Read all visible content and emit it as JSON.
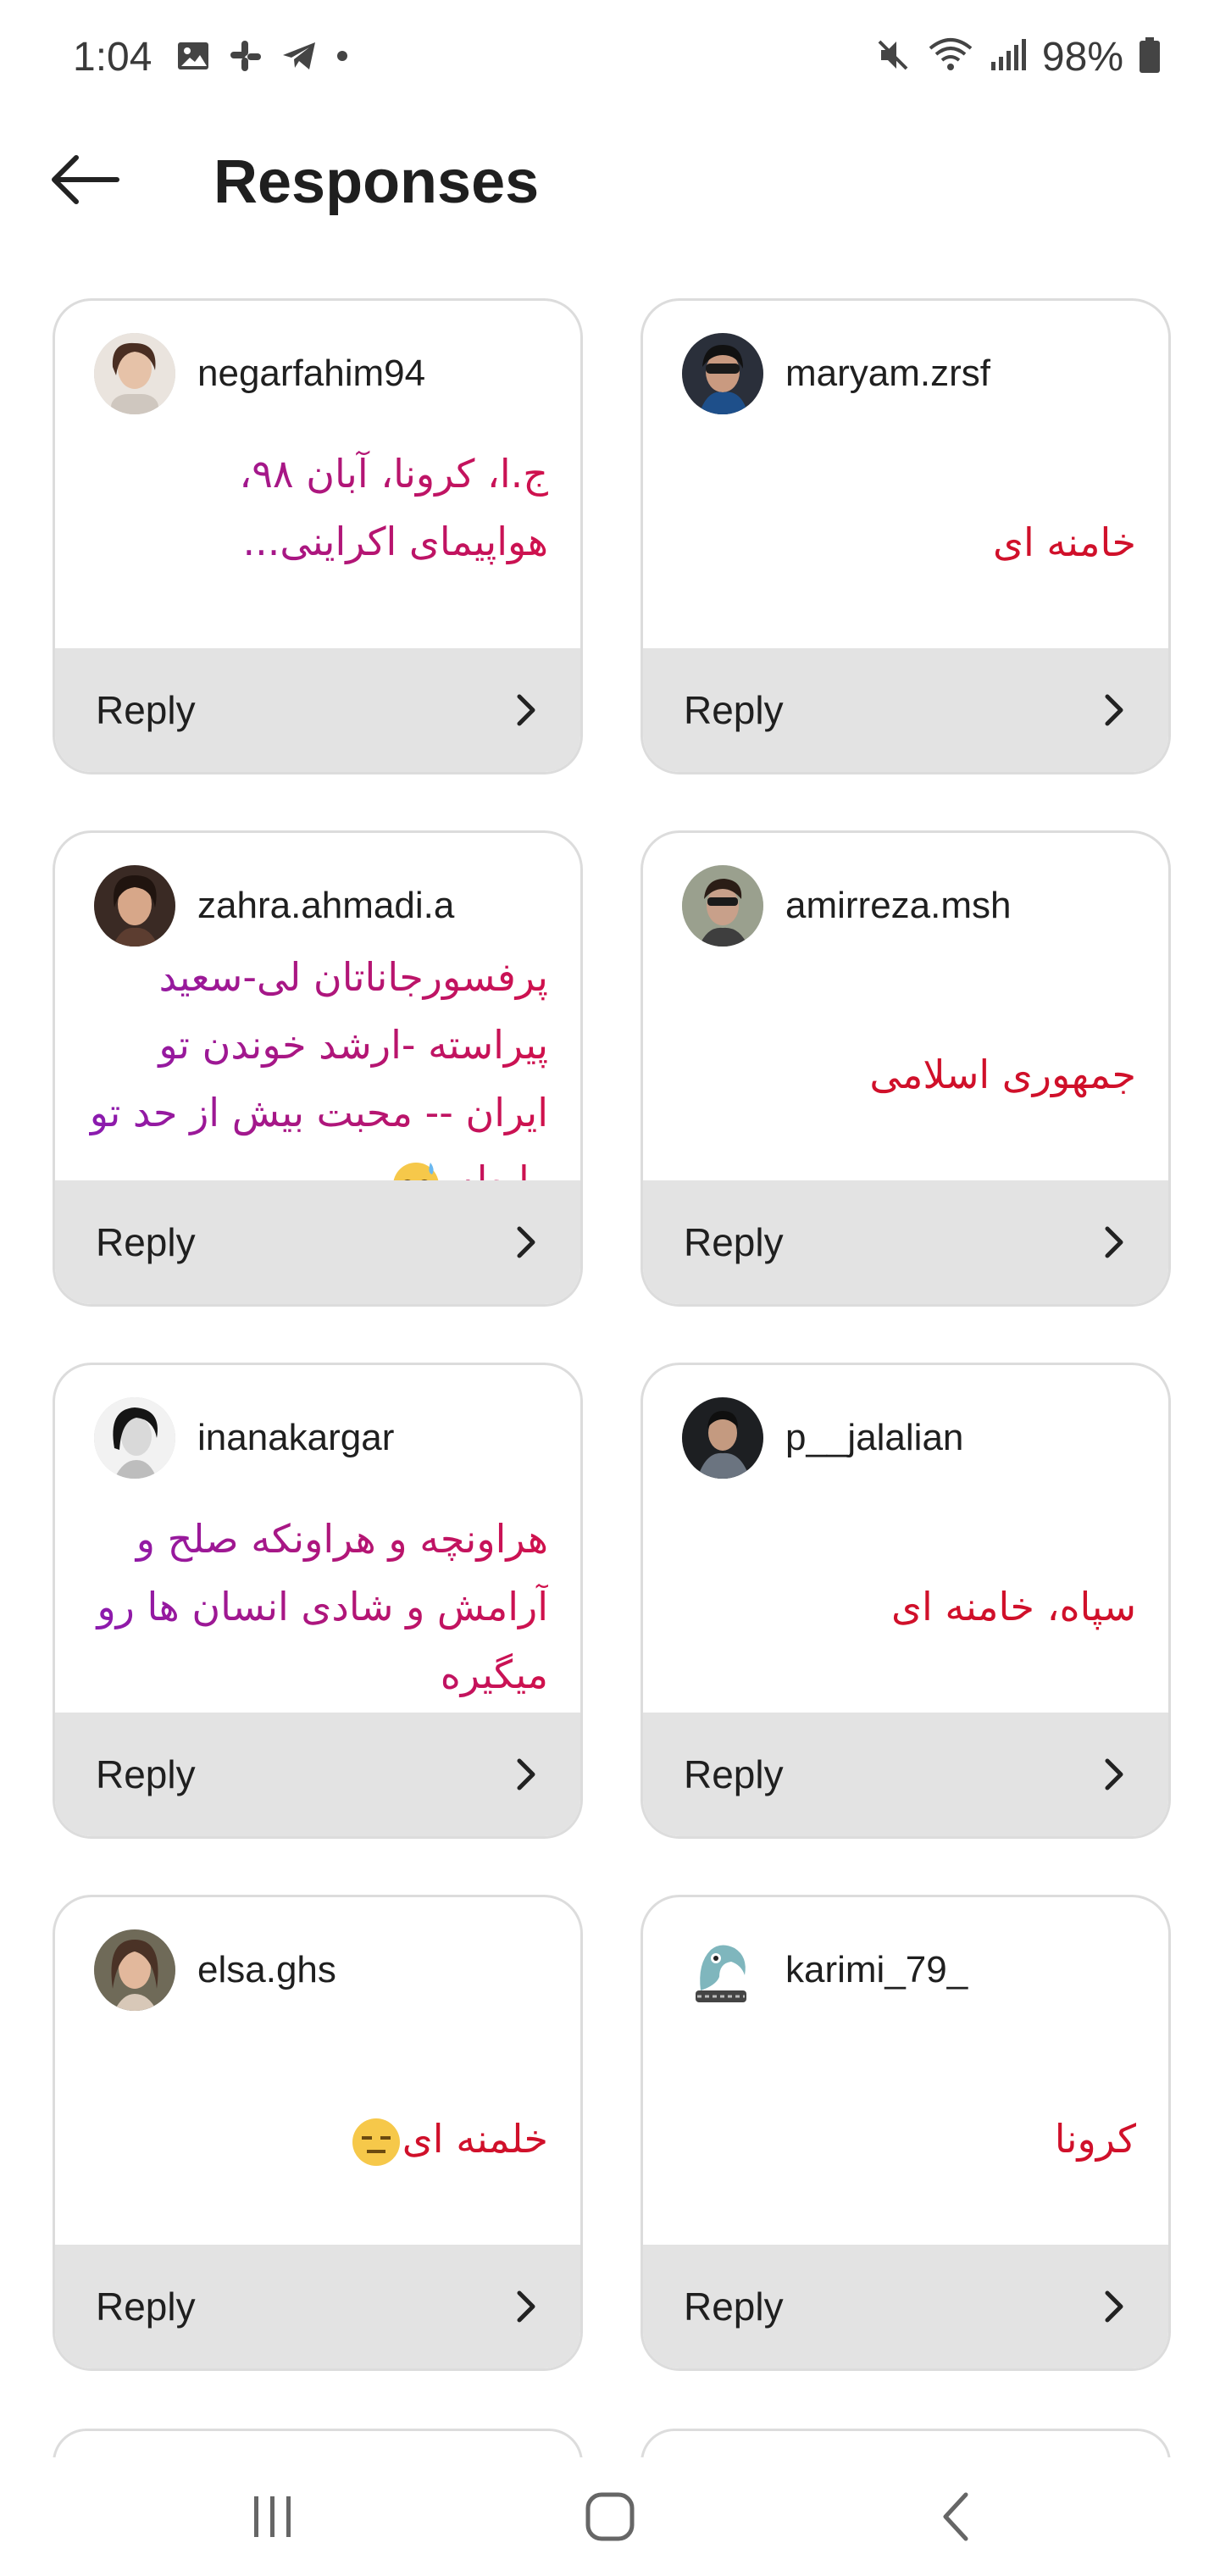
{
  "status_bar": {
    "time": "1:04",
    "battery": "98%",
    "left_icons": [
      "image-icon",
      "slack-icon",
      "telegram-icon",
      "dot-icon"
    ],
    "right_icons": [
      "mute-icon",
      "wifi-icon",
      "signal-icon",
      "battery-icon"
    ]
  },
  "header": {
    "title": "Responses"
  },
  "reply_label": "Reply",
  "cards": [
    {
      "username": "negarfahim94",
      "message": "ج.ا، کرونا، آبان ۹۸، هواپیمای اکراینی..."
    },
    {
      "username": "maryam.zrsf",
      "message": "خامنه ای"
    },
    {
      "username": "zahra.ahmadi.a",
      "message": "پرفسورجاناتان لی-سعید پیراسته -ارشد خوندن تو ایران -- محبت بیش از حد تو رابطه"
    },
    {
      "username": "amirreza.msh",
      "message": "جمهوری اسلامی"
    },
    {
      "username": "inanakargar",
      "message": "هراونچه و هراونکه صلح و آرامش و شادی انسان ها رو میگیره"
    },
    {
      "username": "p__jalalian",
      "message": "سپاه، خامنه ای"
    },
    {
      "username": "elsa.ghs",
      "message": "خلمنه ای"
    },
    {
      "username": "karimi_79_",
      "message": "کرونا"
    }
  ],
  "nav": {
    "icons": [
      "recent-apps-icon",
      "home-icon",
      "back-nav-icon"
    ]
  }
}
